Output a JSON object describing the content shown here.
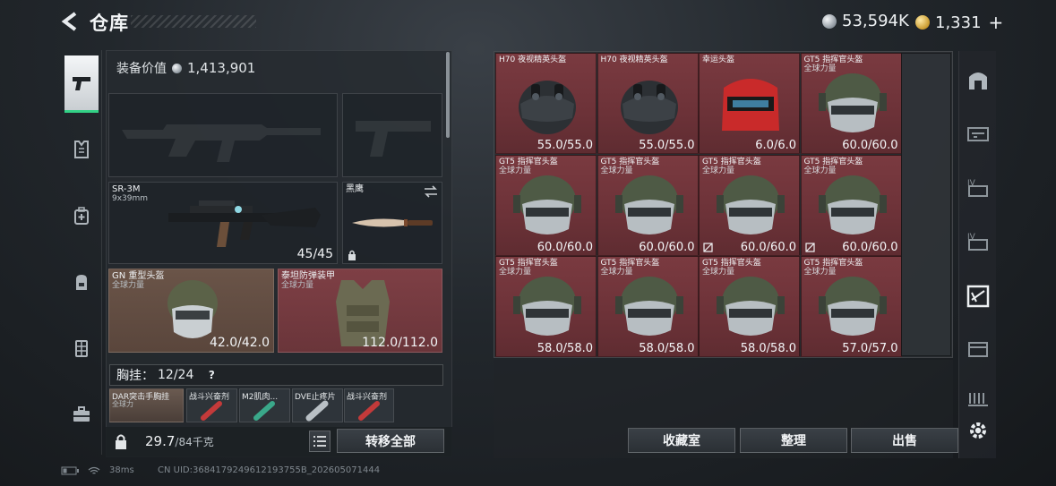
{
  "header": {
    "title": "仓库",
    "silver_amount": "53,594K",
    "gold_amount": "1,331",
    "gold_plus": "+"
  },
  "left_nav": [
    "pistol-icon",
    "armor-icon",
    "medkit-icon",
    "backpack-icon",
    "rig-icon",
    "briefcase-icon"
  ],
  "loadout": {
    "value_label": "装备价值",
    "value": "1,413,901",
    "primary_weapon": {
      "name": "SR-3M",
      "caliber": "9x39mm",
      "ammo": "45/45"
    },
    "melee": {
      "name": "黑鹰"
    },
    "helmet": {
      "name": "GN 重型头盔",
      "sub": "全球力量",
      "durability": "42.0/42.0"
    },
    "armor": {
      "name": "泰坦防弹装甲",
      "sub": "全球力量",
      "durability": "112.0/112.0"
    },
    "chest_rig_label": "胸挂：",
    "chest_rig_capacity": "12/24",
    "chest_help": "?",
    "chest_items": [
      {
        "name": "DAR突击手胸挂",
        "sub": "全球力"
      },
      {
        "name": "战斗兴奋剂",
        "sub": ""
      },
      {
        "name": "M2肌肉...",
        "sub": ""
      },
      {
        "name": "DVE止疼片",
        "sub": ""
      },
      {
        "name": "战斗兴奋剂",
        "sub": ""
      }
    ],
    "weight": "29.7",
    "weight_max": "/84千克",
    "transfer_all": "转移全部"
  },
  "storage": {
    "items": [
      {
        "name": "H70 夜视精英头盔",
        "sub": "",
        "value": "55.0/55.0",
        "kind": "nvg"
      },
      {
        "name": "H70 夜视精英头盔",
        "sub": "",
        "value": "55.0/55.0",
        "kind": "nvg"
      },
      {
        "name": "幸运头盔",
        "sub": "",
        "value": "6.0/6.0",
        "kind": "red"
      },
      {
        "name": "GT5 指挥官头盔",
        "sub": "全球力量",
        "value": "60.0/60.0",
        "kind": "gt5"
      },
      {
        "name": "GT5 指挥官头盔",
        "sub": "全球力量",
        "value": "60.0/60.0",
        "kind": "gt5"
      },
      {
        "name": "GT5 指挥官头盔",
        "sub": "全球力量",
        "value": "60.0/60.0",
        "kind": "gt5"
      },
      {
        "name": "GT5 指挥官头盔",
        "sub": "全球力量",
        "value": "60.0/60.0",
        "kind": "gt5"
      },
      {
        "name": "GT5 指挥官头盔",
        "sub": "全球力量",
        "value": "60.0/60.0",
        "kind": "gt5"
      },
      {
        "name": "GT5 指挥官头盔",
        "sub": "全球力量",
        "value": "58.0/58.0",
        "kind": "gt5"
      },
      {
        "name": "GT5 指挥官头盔",
        "sub": "全球力量",
        "value": "58.0/58.0",
        "kind": "gt5"
      },
      {
        "name": "GT5 指挥官头盔",
        "sub": "全球力量",
        "value": "58.0/58.0",
        "kind": "gt5"
      },
      {
        "name": "GT5 指挥官头盔",
        "sub": "全球力量",
        "value": "57.0/57.0",
        "kind": "gt5"
      }
    ],
    "buttons": {
      "collection": "收藏室",
      "organize": "整理",
      "sell": "出售"
    }
  },
  "right_nav": [
    "vault-icon",
    "weapon-case-icon",
    "storage-iv-icon",
    "storage-iv-2-icon",
    "helmet-case-icon",
    "crate-icon",
    "ammo-icon",
    "settings-icon"
  ],
  "status": {
    "ping": "38ms",
    "uid": "CN UID:3684179249612193755B_202605071444"
  },
  "colors": {
    "item_red": "#6c3238",
    "item_brown": "#5a463c",
    "active_green": "#33d186"
  }
}
